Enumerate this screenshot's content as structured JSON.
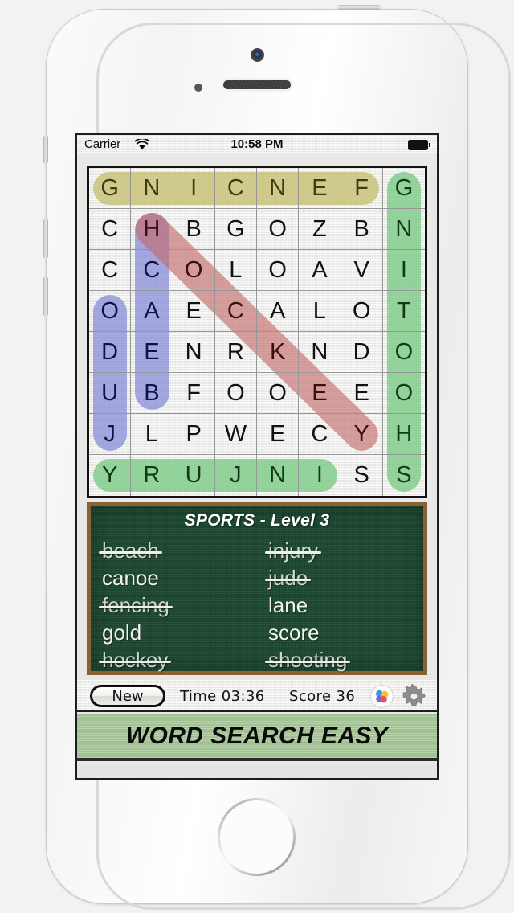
{
  "device": {
    "name": "iphone-5s-white",
    "icons": {
      "front_camera": "camera-icon",
      "earpiece": "speaker-grille-icon",
      "proximity": "proximity-sensor-icon",
      "home": "home-button-icon"
    }
  },
  "status_bar": {
    "carrier": "Carrier",
    "wifi_icon": "wifi-icon",
    "time": "10:58 PM",
    "battery_icon": "battery-full-icon"
  },
  "grid": {
    "rows": 8,
    "cols": 8,
    "letters": [
      [
        "G",
        "N",
        "I",
        "C",
        "N",
        "E",
        "F",
        "G"
      ],
      [
        "C",
        "H",
        "B",
        "G",
        "O",
        "Z",
        "B",
        "N"
      ],
      [
        "C",
        "C",
        "O",
        "L",
        "O",
        "A",
        "V",
        "I"
      ],
      [
        "O",
        "A",
        "E",
        "C",
        "A",
        "L",
        "O",
        "T"
      ],
      [
        "D",
        "E",
        "N",
        "R",
        "K",
        "N",
        "D",
        "O"
      ],
      [
        "U",
        "B",
        "F",
        "O",
        "O",
        "E",
        "E",
        "O"
      ],
      [
        "J",
        "L",
        "P",
        "W",
        "E",
        "C",
        "Y",
        "H"
      ],
      [
        "Y",
        "R",
        "U",
        "J",
        "N",
        "I",
        "S",
        "S"
      ]
    ],
    "highlights": [
      {
        "word": "fencing",
        "color_name": "olive",
        "color": "#c5bf6e",
        "tint": "yellow",
        "orientation": "horizontal-reversed",
        "row": 0,
        "col_start": 0,
        "col_end": 6
      },
      {
        "word": "shooting",
        "color_name": "green",
        "color": "#7ac984",
        "tint": "green",
        "orientation": "vertical",
        "col": 7,
        "row_start": 0,
        "row_end": 7
      },
      {
        "word": "injury",
        "color_name": "green",
        "color": "#7ac984",
        "tint": "green",
        "orientation": "horizontal-reversed",
        "row": 7,
        "col_start": 0,
        "col_end": 5
      },
      {
        "word": "hockey",
        "color_name": "blue",
        "color": "#7a7fd4",
        "tint": "blue",
        "orientation": "vertical-reversed",
        "col": 1,
        "row_start": 1,
        "row_end": 5
      },
      {
        "word": "judo",
        "color_name": "blue",
        "color": "#7a7fd4",
        "tint": "blue",
        "orientation": "vertical",
        "col": 0,
        "row_start": 3,
        "row_end": 6
      },
      {
        "word": "beach",
        "color_name": "red",
        "color": "#c46868",
        "tint": "red",
        "orientation": "diagonal-down-right",
        "row_start": 1,
        "col_start": 1,
        "length": 6
      }
    ]
  },
  "word_panel": {
    "title": "SPORTS - Level 3",
    "board_color": "#1e4b32",
    "frame_color": "#8a6232",
    "columns": [
      [
        {
          "word": "beach",
          "found": true
        },
        {
          "word": "canoe",
          "found": false
        },
        {
          "word": "fencing",
          "found": true
        },
        {
          "word": "gold",
          "found": false
        },
        {
          "word": "hockey",
          "found": true
        }
      ],
      [
        {
          "word": "injury",
          "found": true
        },
        {
          "word": "judo",
          "found": true
        },
        {
          "word": "lane",
          "found": false
        },
        {
          "word": "score",
          "found": false
        },
        {
          "word": "shooting",
          "found": true
        }
      ]
    ]
  },
  "toolbar": {
    "new_label": "New",
    "time_label": "Time 03:36",
    "score_label": "Score 36",
    "gamecenter_icon": "game-center-icon",
    "settings_icon": "gear-icon"
  },
  "banner": {
    "text": "WORD SEARCH EASY",
    "background": "#a8c99a"
  }
}
